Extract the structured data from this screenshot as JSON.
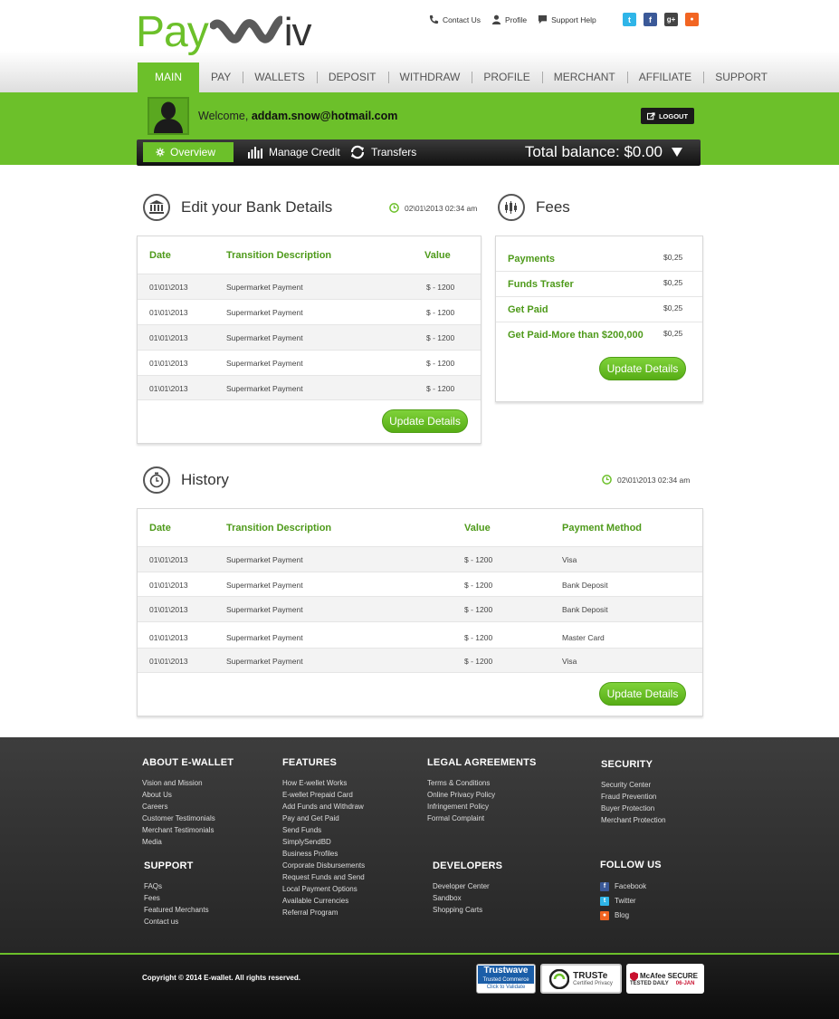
{
  "brand": {
    "logo_left": "Pay",
    "logo_right": "iv"
  },
  "toplinks": [
    {
      "label": "Contact Us",
      "icon": "phone-icon"
    },
    {
      "label": "Profile",
      "icon": "user-icon"
    },
    {
      "label": "Support Help",
      "icon": "speech-bubble-icon"
    }
  ],
  "social": [
    {
      "icon": "twitter-icon",
      "glyph": "t",
      "color": "#2fb5e8"
    },
    {
      "icon": "facebook-icon",
      "glyph": "f",
      "color": "#3b5998"
    },
    {
      "icon": "googleplus-icon",
      "glyph": "g+",
      "color": "#444444"
    },
    {
      "icon": "rss-icon",
      "glyph": "●",
      "color": "#f26522"
    }
  ],
  "nav": [
    "MAIN",
    "PAY",
    "WALLETS",
    "DEPOSIT",
    "WITHDRAW",
    "PROFILE",
    "MERCHANT",
    "AFFILIATE",
    "SUPPORT"
  ],
  "user": {
    "welcome": "Welcome,",
    "email": "addam.snow@hotmail.com",
    "logout": "LOGOUT"
  },
  "subnav": {
    "overview": "Overview",
    "manage_credit": "Manage Credit",
    "transfers": "Transfers",
    "balance": "Total balance: $0.00"
  },
  "bank": {
    "title": "Edit your Bank Details",
    "timestamp": "02\\01\\2013 02:34 am",
    "columns": [
      "Date",
      "Transition Description",
      "Value"
    ],
    "rows": [
      [
        "01\\01\\2013",
        "Supermarket Payment",
        "$ - 1200"
      ],
      [
        "01\\01\\2013",
        "Supermarket Payment",
        "$ - 1200"
      ],
      [
        "01\\01\\2013",
        "Supermarket Payment",
        "$ - 1200"
      ],
      [
        "01\\01\\2013",
        "Supermarket Payment",
        "$ - 1200"
      ],
      [
        "01\\01\\2013",
        "Supermarket Payment",
        "$ - 1200"
      ]
    ],
    "button": "Update Details"
  },
  "fees": {
    "title": "Fees",
    "items": [
      {
        "label": "Payments",
        "value": "$0,25"
      },
      {
        "label": "Funds Trasfer",
        "value": "$0,25"
      },
      {
        "label": "Get Paid",
        "value": "$0,25"
      },
      {
        "label": "Get Paid-More than $200,000",
        "value": "$0,25"
      }
    ],
    "button": "Update Details"
  },
  "history": {
    "title": "History",
    "timestamp": "02\\01\\2013 02:34 am",
    "columns": [
      "Date",
      "Transition Description",
      "Value",
      "Payment Method"
    ],
    "rows": [
      [
        "01\\01\\2013",
        "Supermarket Payment",
        "$ - 1200",
        "Visa"
      ],
      [
        "01\\01\\2013",
        "Supermarket Payment",
        "$ - 1200",
        "Bank Deposit"
      ],
      [
        "01\\01\\2013",
        "Supermarket Payment",
        "$ - 1200",
        "Bank Deposit"
      ],
      [
        "01\\01\\2013",
        "Supermarket Payment",
        "$ - 1200",
        "Master Card"
      ],
      [
        "01\\01\\2013",
        "Supermarket Payment",
        "$ - 1200",
        "Visa"
      ]
    ],
    "button": "Update Details"
  },
  "footer": {
    "about": {
      "title": "ABOUT E-WALLET",
      "links": [
        "Vision and Mission",
        "About Us",
        "Careers",
        "Customer Testimonials",
        "Merchant Testimonials",
        "Media"
      ]
    },
    "support": {
      "title": "SUPPORT",
      "links": [
        "FAQs",
        "Fees",
        "Featured Merchants",
        "Contact us"
      ]
    },
    "features": {
      "title": "FEATURES",
      "links": [
        "How E-wellet Works",
        "E-wellet Prepaid Card",
        "Add Funds and Withdraw",
        "Pay and Get Paid",
        "Send Funds",
        "SimplySendBD",
        "Business Profiles",
        "Corporate Disbursements",
        "Request Funds and Send",
        "Local Payment Options",
        "Available Currencies",
        "Referral Program"
      ]
    },
    "legal": {
      "title": "LEGAL AGREEMENTS",
      "links": [
        "Terms & Conditions",
        "Online Privacy Policy",
        "Infringement Policy",
        "Formal Complaint"
      ]
    },
    "developers": {
      "title": "DEVELOPERS",
      "links": [
        "Developer Center",
        "Sandbox",
        "Shopping Carts"
      ]
    },
    "security": {
      "title": "SECURITY",
      "links": [
        "Security Center",
        "Fraud Prevention",
        "Buyer Protection",
        "Merchant Protection"
      ]
    },
    "follow": {
      "title": "FOLLOW US",
      "links": [
        "Facebook",
        "Twitter",
        "Blog"
      ]
    }
  },
  "copyright": "Copyright © 2014 E-wallet. All rights reserved.",
  "badges": {
    "trustwave": {
      "name": "Trustwave",
      "line1": "Trusted Commerce",
      "line2": "Click to Validate"
    },
    "truste": {
      "name": "TRUSTe",
      "line1": "Certified Privacy"
    },
    "mcafee": {
      "name": "McAfee SECURE",
      "line1": "TESTED DAILY",
      "date": "06-JAN"
    }
  }
}
